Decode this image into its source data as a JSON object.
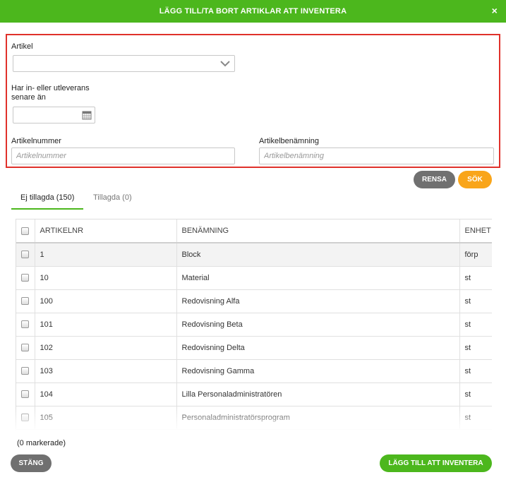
{
  "dialog": {
    "title": "LÄGG TILL/TA BORT ARTIKLAR ATT INVENTERA",
    "close_symbol": "×"
  },
  "filters": {
    "artikel_label": "Artikel",
    "artikel_value": "",
    "date_label_line1": "Har in- eller utleverans",
    "date_label_line2": "senare än",
    "date_value": "",
    "artikelnummer_label": "Artikelnummer",
    "artikelnummer_placeholder": "Artikelnummer",
    "benamning_label": "Artikelbenämning",
    "benamning_placeholder": "Artikelbenämning"
  },
  "actions": {
    "clear_label": "RENSA",
    "search_label": "SÖK"
  },
  "tabs": [
    {
      "label": "Ej tillagda (150)",
      "active": true
    },
    {
      "label": "Tillagda (0)",
      "active": false
    }
  ],
  "table": {
    "headers": {
      "artikelnr": "ARTIKELNR",
      "benamning": "BENÄMNING",
      "enhet": "ENHET"
    },
    "rows": [
      {
        "artikelnr": "1",
        "benamning": "Block",
        "enhet": "förp"
      },
      {
        "artikelnr": "10",
        "benamning": "Material",
        "enhet": "st"
      },
      {
        "artikelnr": "100",
        "benamning": "Redovisning Alfa",
        "enhet": "st"
      },
      {
        "artikelnr": "101",
        "benamning": "Redovisning Beta",
        "enhet": "st"
      },
      {
        "artikelnr": "102",
        "benamning": "Redovisning Delta",
        "enhet": "st"
      },
      {
        "artikelnr": "103",
        "benamning": "Redovisning Gamma",
        "enhet": "st"
      },
      {
        "artikelnr": "104",
        "benamning": "Lilla Personaladministratören",
        "enhet": "st"
      },
      {
        "artikelnr": "105",
        "benamning": "Personaladministratörsprogram",
        "enhet": "st"
      }
    ]
  },
  "footer": {
    "selected_count": "(0 markerade)",
    "close_label": "STÄNG",
    "add_label": "LÄGG TILL ATT INVENTERA"
  },
  "colors": {
    "brand_green": "#4cb71d",
    "highlight_red": "#e0312b",
    "search_orange": "#f9a51a",
    "neutral_button": "#707070"
  },
  "icons": {
    "close": "close-icon",
    "dropdown": "chevron-down-icon",
    "calendar": "calendar-icon",
    "checkbox": "checkbox-icon"
  }
}
